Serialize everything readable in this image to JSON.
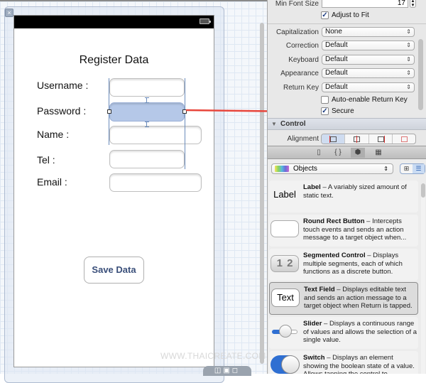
{
  "canvas": {
    "screen_title": "Register Data",
    "fields": [
      {
        "label": "Username :",
        "value": ""
      },
      {
        "label": "Password :",
        "value": ""
      },
      {
        "label": "Name :",
        "value": ""
      },
      {
        "label": "Tel :",
        "value": ""
      },
      {
        "label": "Email :",
        "value": ""
      }
    ],
    "save_button": "Save Data",
    "watermark": "WWW.THAICREATE.COM",
    "close_icon": "×",
    "zoom_controls": "◫▣◻"
  },
  "inspector": {
    "min_font_size": {
      "label": "Min Font Size",
      "value": "17"
    },
    "adjust_to_fit": {
      "label": "Adjust to Fit",
      "checked": true
    },
    "rows": [
      {
        "label": "Capitalization",
        "value": "None"
      },
      {
        "label": "Correction",
        "value": "Default"
      },
      {
        "label": "Keyboard",
        "value": "Default"
      },
      {
        "label": "Appearance",
        "value": "Default"
      },
      {
        "label": "Return Key",
        "value": "Default"
      }
    ],
    "auto_enable_return_key": {
      "label": "Auto-enable Return Key",
      "checked": false
    },
    "secure": {
      "label": "Secure",
      "checked": true
    },
    "control_section": "Control",
    "alignment_label": "Alignment",
    "alignment_options": [
      "left",
      "center",
      "right",
      "fill"
    ],
    "alignment_selected": "left",
    "chevron": "⇕",
    "check_mark": "✓"
  },
  "library": {
    "tabs": [
      "file-template",
      "code-snippet",
      "object-library",
      "media-library"
    ],
    "tab_glyphs": [
      "▯",
      "{ }",
      "⬢",
      "▦"
    ],
    "active_tab": "object-library",
    "filter_popup": "Objects",
    "view_modes": [
      "⊞",
      "☰"
    ],
    "items": [
      {
        "icon_text": "Label",
        "name": "Label",
        "desc": " – A variably sized amount of static text."
      },
      {
        "icon_text": "",
        "name": "Round Rect Button",
        "desc": " – Intercepts touch events and sends an action message to a target object when..."
      },
      {
        "icon_text": "1 2",
        "name": "Segmented Control",
        "desc": " – Displays multiple segments, each of which functions as a discrete button."
      },
      {
        "icon_text": "Text",
        "name": "Text Field",
        "desc": " – Displays editable text and sends an action message to a target object when Return is tapped."
      },
      {
        "icon_text": "",
        "name": "Slider",
        "desc": " – Displays a continuous range of values and allows the selection of a single value."
      },
      {
        "icon_text": "",
        "name": "Switch",
        "desc": " – Displays an element showing the boolean state of a value. Allows tapping the control to..."
      }
    ]
  },
  "colors": {
    "selection_fill": "#b5c8e8",
    "arrow": "#e8463c",
    "button_text": "#3a4f7a"
  }
}
